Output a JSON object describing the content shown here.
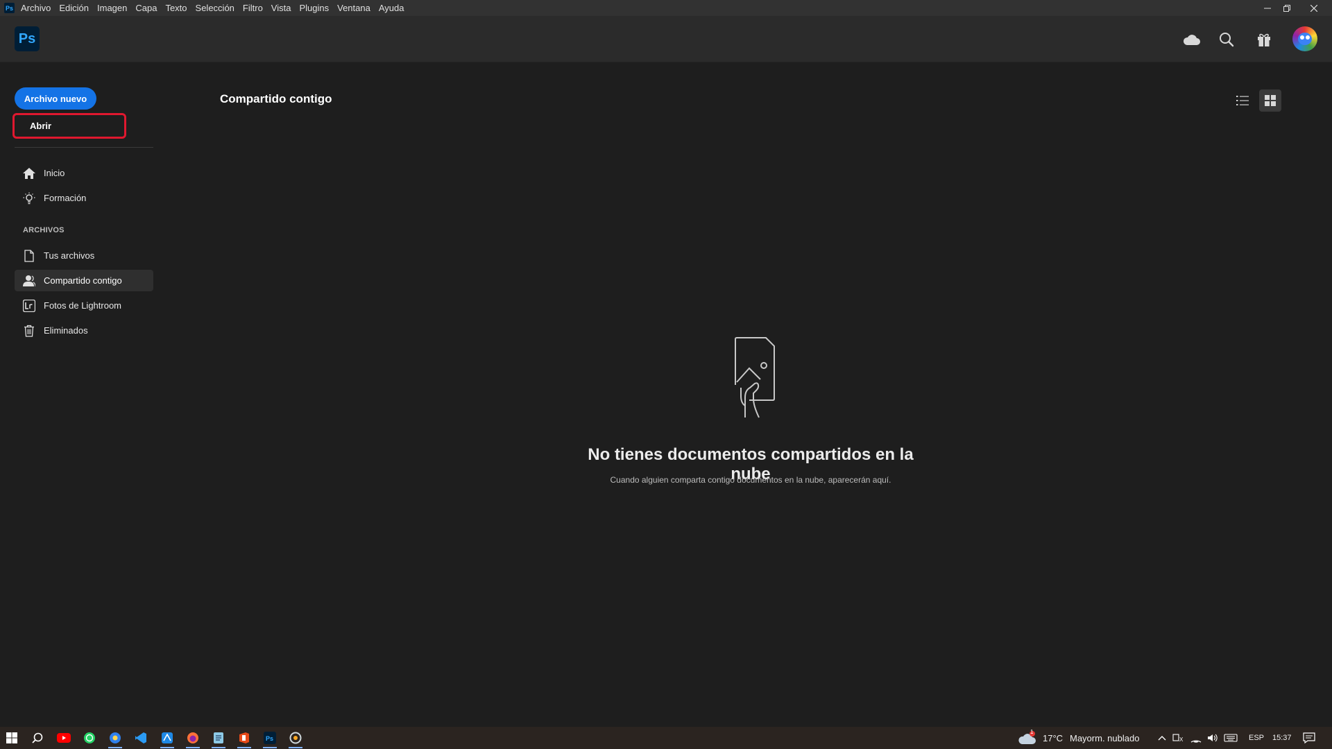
{
  "menubar": {
    "app_icon": "Ps",
    "items": [
      "Archivo",
      "Edición",
      "Imagen",
      "Capa",
      "Texto",
      "Selección",
      "Filtro",
      "Vista",
      "Plugins",
      "Ventana",
      "Ayuda"
    ],
    "controls": [
      "minimize-icon",
      "restore-icon",
      "close-icon"
    ]
  },
  "header": {
    "logo": "Ps",
    "icons": [
      "cloud-icon",
      "search-icon",
      "gift-icon",
      "avatar"
    ],
    "accent": "#31a8ff"
  },
  "sidebar": {
    "new_file": "Archivo nuevo",
    "open": "Abrir",
    "nav": [
      {
        "label": "Inicio",
        "icon": "home-icon"
      },
      {
        "label": "Formación",
        "icon": "lightbulb-icon"
      }
    ],
    "section_label": "ARCHIVOS",
    "files": [
      {
        "label": "Tus archivos",
        "icon": "document-icon"
      },
      {
        "label": "Compartido contigo",
        "icon": "person-icon",
        "active": true
      },
      {
        "label": "Fotos de Lightroom",
        "icon": "lightroom-icon"
      },
      {
        "label": "Eliminados",
        "icon": "trash-icon"
      }
    ],
    "button_color": "#1473e6",
    "highlight_color": "#e0182f"
  },
  "main": {
    "title": "Compartido contigo",
    "view_modes": [
      "list-view-icon",
      "grid-view-icon"
    ],
    "active_view": "grid",
    "empty_title": "No tienes documentos compartidos en la nube",
    "empty_subtitle": "Cuando alguien comparta contigo documentos en la nube, aparecerán aquí."
  },
  "taskbar": {
    "apps": [
      "start-icon",
      "search-icon",
      "youtube-icon",
      "whatsapp-icon",
      "app-icon",
      "vscode-icon",
      "app-icon",
      "firefox-icon",
      "notepad-icon",
      "office-icon",
      "photoshop-icon",
      "app-icon"
    ],
    "weather": {
      "temp": "17°C",
      "condition": "Mayorm. nublado",
      "alert": "1"
    },
    "language": "ESP",
    "time": "15:37"
  }
}
